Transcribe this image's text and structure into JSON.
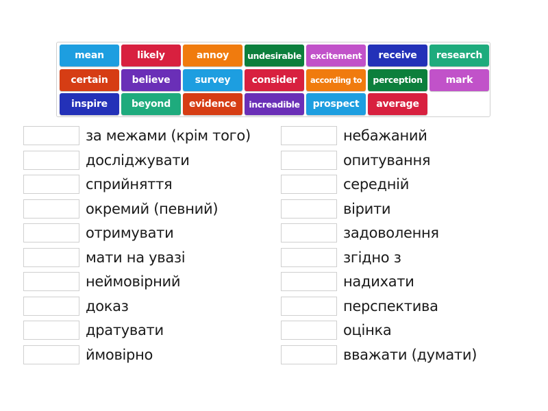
{
  "tiles": [
    {
      "label": "mean",
      "color": "#1d9ee0"
    },
    {
      "label": "likely",
      "color": "#d8203f"
    },
    {
      "label": "annoy",
      "color": "#f07b0e"
    },
    {
      "label": "undesirable",
      "color": "#0c7f3c"
    },
    {
      "label": "excitement",
      "color": "#c152c9"
    },
    {
      "label": "receive",
      "color": "#2331b8"
    },
    {
      "label": "research",
      "color": "#1eab7d"
    },
    {
      "label": "certain",
      "color": "#d63d14"
    },
    {
      "label": "believe",
      "color": "#6a2fb7"
    },
    {
      "label": "survey",
      "color": "#1d9ee0"
    },
    {
      "label": "consider",
      "color": "#d8203f"
    },
    {
      "label": "according to",
      "color": "#f07b0e"
    },
    {
      "label": "perception",
      "color": "#0c7f3c"
    },
    {
      "label": "mark",
      "color": "#c152c9"
    },
    {
      "label": "inspire",
      "color": "#2331b8"
    },
    {
      "label": "beyond",
      "color": "#1eab7d"
    },
    {
      "label": "evidence",
      "color": "#d63d14"
    },
    {
      "label": "increadible",
      "color": "#6a2fb7"
    },
    {
      "label": "prospect",
      "color": "#1d9ee0"
    },
    {
      "label": "average",
      "color": "#d8203f"
    }
  ],
  "left_column": [
    {
      "label": "за межами (крім того)",
      "answer": ""
    },
    {
      "label": "досліджувати",
      "answer": ""
    },
    {
      "label": "сприйняття",
      "answer": ""
    },
    {
      "label": "окремий (певний)",
      "answer": ""
    },
    {
      "label": "отримувати",
      "answer": ""
    },
    {
      "label": "мати на увазі",
      "answer": ""
    },
    {
      "label": "неймовірний",
      "answer": ""
    },
    {
      "label": "доказ",
      "answer": ""
    },
    {
      "label": "дратувати",
      "answer": ""
    },
    {
      "label": "ймовірно",
      "answer": ""
    }
  ],
  "right_column": [
    {
      "label": "небажаний",
      "answer": ""
    },
    {
      "label": "опитування",
      "answer": ""
    },
    {
      "label": "середній",
      "answer": ""
    },
    {
      "label": "вірити",
      "answer": ""
    },
    {
      "label": "задоволення",
      "answer": ""
    },
    {
      "label": "згідно з",
      "answer": ""
    },
    {
      "label": "надихати",
      "answer": ""
    },
    {
      "label": "перспектива",
      "answer": ""
    },
    {
      "label": "оцінка",
      "answer": ""
    },
    {
      "label": "вважати (думати)",
      "answer": ""
    }
  ]
}
